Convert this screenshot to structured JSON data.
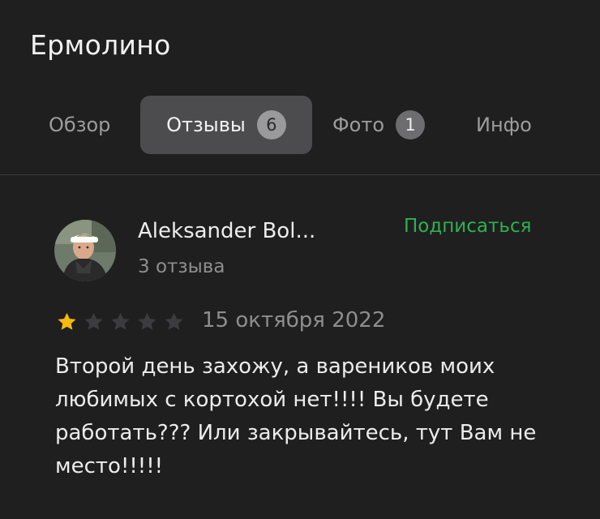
{
  "header": {
    "title": "Ермолино"
  },
  "tabs": [
    {
      "label": "Обзор"
    },
    {
      "label": "Отзывы",
      "count": "6",
      "active": true
    },
    {
      "label": "Фото",
      "count": "1"
    },
    {
      "label": "Инфо"
    }
  ],
  "review": {
    "author": "Aleksander Bol...",
    "reviews_count": "3 отзыва",
    "subscribe_label": "Подписаться",
    "rating": 1,
    "rating_max": 5,
    "date": "15 октября 2022",
    "text": "Второй день захожу, а вареников моих любимых с кортохой нет!!!! Вы будете работать??? Или закрывайтесь, тут Вам не место!!!!!"
  },
  "colors": {
    "background": "#1f1f20",
    "accent_green": "#2fb14e",
    "star_filled": "#f5b90f",
    "star_empty": "#3c3c3e",
    "active_tab_bg": "#4c4c4e"
  },
  "icons": {
    "rating": "star-icon",
    "avatar": "user-photo"
  }
}
